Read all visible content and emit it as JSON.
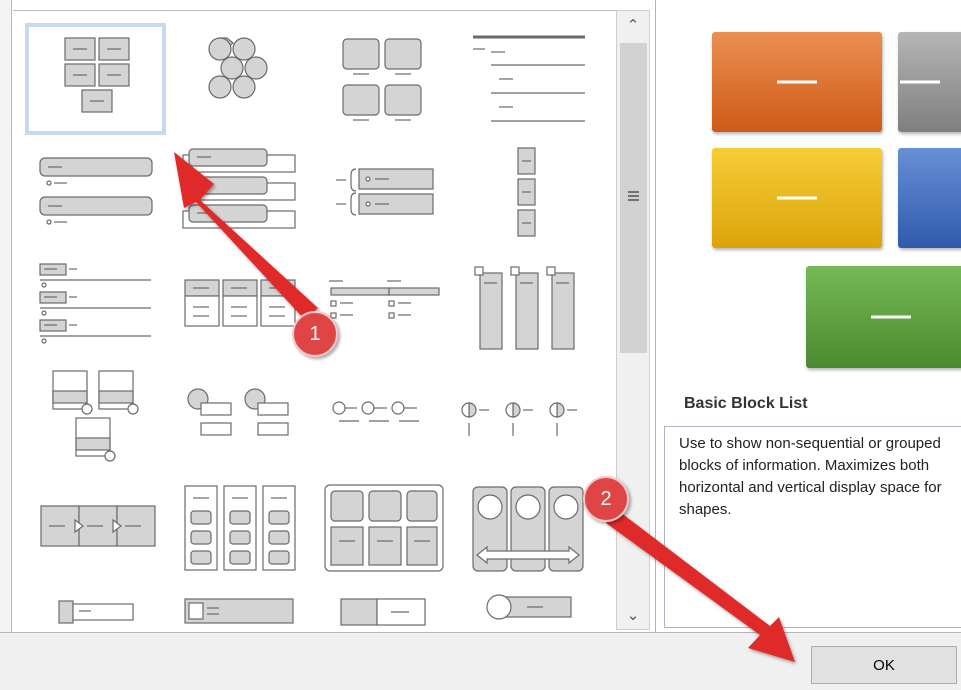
{
  "dialog": {
    "ok_label": "OK"
  },
  "scrollbar": {
    "up_glyph": "▲",
    "down_glyph": "▼"
  },
  "preview": {
    "title": "Basic Block List",
    "description": "Use to show non-sequential or grouped blocks of information. Maximizes both horizontal and vertical display space for shapes.",
    "colors": {
      "orange": "#e06c29",
      "gray": "#8f8f8f",
      "gold": "#f2b90f",
      "blue": "#3f6fc4",
      "green": "#5a9e3f"
    }
  },
  "annotations": [
    {
      "number": "1",
      "points_to": "selected-layout-thumbnail"
    },
    {
      "number": "2",
      "points_to": "ok-button"
    }
  ],
  "gallery": {
    "selected_index": 0,
    "thumbnail_icons": [
      "basic-block-list-icon",
      "alternating-hexagons-icon",
      "picture-caption-list-icon",
      "lined-list-icon",
      "vertical-bullet-list-icon",
      "vertical-box-list-icon",
      "horizontal-bracket-list-icon",
      "stacked-list-icon",
      "table-list-icon",
      "horizontal-bullet-list-icon",
      "square-accent-list-icon",
      "picture-accent-list-icon",
      "bending-picture-caption-icon",
      "circle-accent-timeline-icon",
      "lined-timeline-icon",
      "half-circle-list-icon",
      "process-list-icon",
      "grouped-list-icon",
      "table-hierarchy-icon",
      "arrow-cycle-list-icon",
      "bullet-list-icon",
      "picture-strip-icon",
      "split-list-icon",
      "circle-callout-icon"
    ]
  }
}
